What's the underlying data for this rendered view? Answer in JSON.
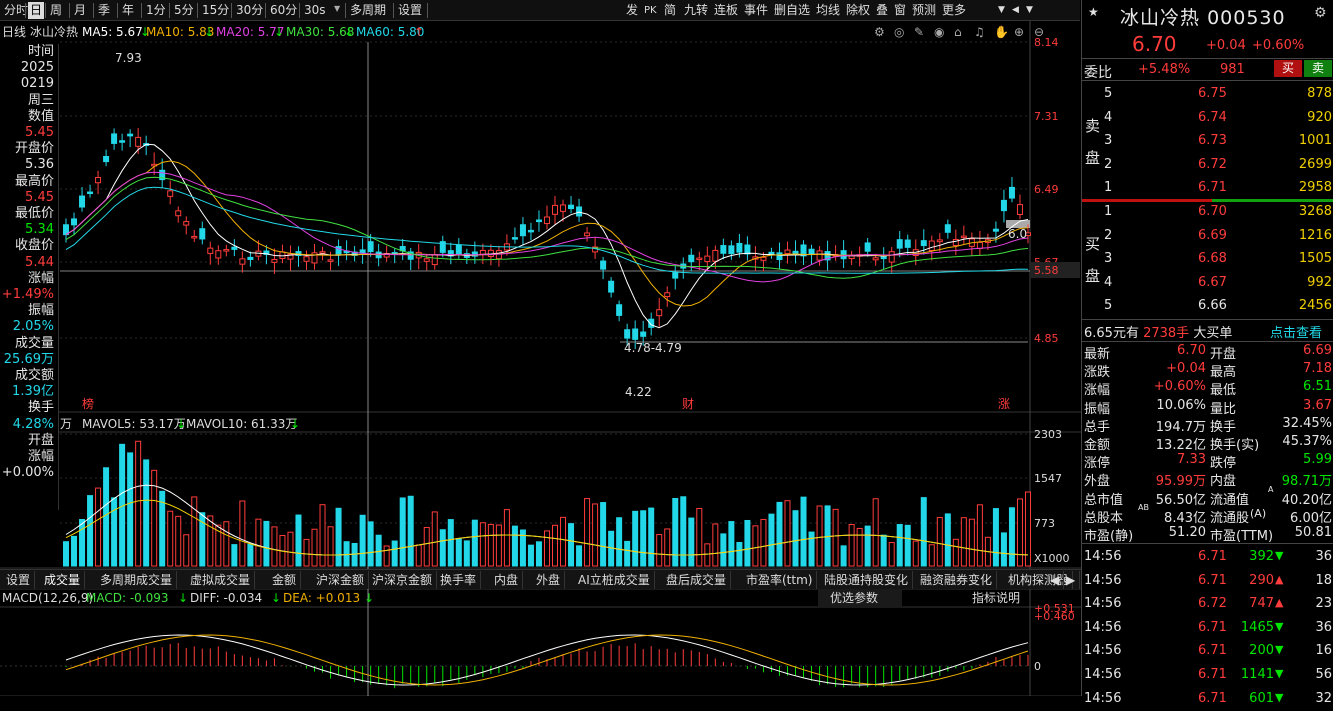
{
  "toolbar": {
    "left": [
      "分时",
      "日",
      "周",
      "月",
      "季",
      "年",
      "1分",
      "5分",
      "15分",
      "30分",
      "60分",
      "30s",
      "多周期",
      "设置"
    ],
    "selected_index": 1,
    "right": [
      "发",
      "PK",
      "简",
      "九转",
      "连板",
      "事件",
      "删自选",
      "均线",
      "除权",
      "叠",
      "窗",
      "预测",
      "更多"
    ]
  },
  "legend": {
    "period": "日线",
    "name": "冰山冷热",
    "ma": [
      {
        "label": "MA5: 5.67",
        "arrow": "↓",
        "color": "#ffffff"
      },
      {
        "label": "MA10: 5.83",
        "arrow": "↓",
        "color": "#f0b000"
      },
      {
        "label": "MA20: 5.77",
        "arrow": "↓",
        "color": "#e040e0"
      },
      {
        "label": "MA30: 5.68",
        "arrow": "↓",
        "color": "#40e040"
      },
      {
        "label": "MA60: 5.80",
        "arrow": "↑",
        "color": "#22d8e8"
      }
    ]
  },
  "price_axis": [
    "8.14",
    "7.31",
    "6.49",
    "5.67",
    "4.85"
  ],
  "volume_axis": [
    "2303",
    "1547",
    "773",
    "X1000"
  ],
  "macd_axis": [
    "+0.531",
    "+0.460",
    "0"
  ],
  "cursor_price": "5.58",
  "annotations": {
    "high": "7.93",
    "low": "4.22",
    "range": "4.78-4.79",
    "level": "6.0",
    "bang": "榜",
    "cai": "财",
    "zhang": "涨"
  },
  "vol_legend": {
    "unit": "万",
    "mavol5": "MAVOL5: 53.17万",
    "mavol5_arrow": "↓",
    "mavol10": "MAVOL10: 61.33万",
    "mavol10_arrow": "↓"
  },
  "macd_legend": {
    "title": "MACD(12,26,9)",
    "macd": "MACD: -0.093",
    "macd_arrow": "↓",
    "diff": "DIFF: -0.034",
    "diff_arrow": "↓",
    "dea": "DEA: +0.013",
    "dea_arrow": "↓"
  },
  "macd_buttons": {
    "optimize": "优选参数",
    "explain": "指标说明"
  },
  "sidebar": [
    {
      "label": "时间",
      "value": "2025"
    },
    {
      "label": "",
      "value": "0219"
    },
    {
      "label": "周三",
      "value": ""
    },
    {
      "label": "数值",
      "value": "5.45",
      "color": "red"
    },
    {
      "label": "开盘价",
      "value": "5.36",
      "color": "wht"
    },
    {
      "label": "最高价",
      "value": "5.45",
      "color": "red"
    },
    {
      "label": "最低价",
      "value": "5.34",
      "color": "grn"
    },
    {
      "label": "收盘价",
      "value": "5.44",
      "color": "red"
    },
    {
      "label": "涨幅",
      "value": "+1.49%",
      "color": "red"
    },
    {
      "label": "振幅",
      "value": "2.05%",
      "color": "cyn"
    },
    {
      "label": "成交量",
      "value": "25.69万",
      "color": "cyn"
    },
    {
      "label": "成交额",
      "value": "1.39亿",
      "color": "cyn"
    },
    {
      "label": "换手",
      "value": "4.28%",
      "color": "cyn"
    },
    {
      "label": "开盘",
      "value": ""
    },
    {
      "label": "涨幅",
      "value": "+0.00%",
      "color": "wht"
    }
  ],
  "tabs": [
    "设置",
    "成交量",
    "多周期成交量",
    "虚拟成交量",
    "金额",
    "沪深金额",
    "沪深京金额",
    "换手率",
    "内盘",
    "外盘",
    "AI立桩成交量",
    "盘后成交量",
    "市盈率(ttm)",
    "陆股通持股变化",
    "融资融券变化",
    "机构探测器"
  ],
  "stock": {
    "name": "冰山冷热",
    "code": "000530",
    "price": "6.70",
    "change": "+0.04",
    "pct": "+0.60%"
  },
  "weibi": {
    "label": "委比",
    "pct": "+5.48%",
    "val": "981",
    "buy": "买",
    "sell": "卖"
  },
  "sell_book": [
    {
      "n": "5",
      "p": "6.75",
      "v": "878"
    },
    {
      "n": "4",
      "p": "6.74",
      "v": "920"
    },
    {
      "n": "3",
      "p": "6.73",
      "v": "1001"
    },
    {
      "n": "2",
      "p": "6.72",
      "v": "2699"
    },
    {
      "n": "1",
      "p": "6.71",
      "v": "2958"
    }
  ],
  "buy_book": [
    {
      "n": "1",
      "p": "6.70",
      "v": "3268"
    },
    {
      "n": "2",
      "p": "6.69",
      "v": "1216"
    },
    {
      "n": "3",
      "p": "6.68",
      "v": "1505"
    },
    {
      "n": "4",
      "p": "6.67",
      "v": "992"
    },
    {
      "n": "5",
      "p": "6.66",
      "v": "2456"
    }
  ],
  "book_side": {
    "sell": [
      "卖",
      "盘"
    ],
    "buy": [
      "买",
      "盘"
    ]
  },
  "big_order": {
    "price": "6.65元有",
    "vol": "2738手",
    "label": "大买单",
    "link": "点击查看"
  },
  "quote": [
    [
      "最新",
      "6.70",
      "red",
      "开盘",
      "6.69",
      "red"
    ],
    [
      "涨跌",
      "+0.04",
      "red",
      "最高",
      "7.18",
      "red"
    ],
    [
      "涨幅",
      "+0.60%",
      "red",
      "最低",
      "6.51",
      "grn"
    ],
    [
      "振幅",
      "10.06%",
      "wht",
      "量比",
      "3.67",
      "red"
    ],
    [
      "总手",
      "194.7万",
      "wht",
      "换手",
      "32.45%",
      "wht"
    ],
    [
      "金额",
      "13.22亿",
      "wht",
      "换手(实)",
      "45.37%",
      "wht"
    ],
    [
      "涨停",
      "7.33",
      "red",
      "跌停",
      "5.99",
      "grn"
    ],
    [
      "外盘",
      "95.99万",
      "red",
      "内盘",
      "98.71万",
      "grn"
    ],
    [
      "总市值",
      "56.50亿",
      "wht",
      "流通值",
      "40.20亿",
      "wht"
    ],
    [
      "总股本",
      "8.43亿",
      "wht",
      "流通股",
      "6.00亿",
      "wht"
    ],
    [
      "市盈(静)",
      "51.20",
      "wht",
      "市盈(TTM)",
      "50.81",
      "wht"
    ]
  ],
  "quote_sup": {
    "shizhi": "A",
    "guben": "AB",
    "liutong": "(A)"
  },
  "ticks": [
    {
      "t": "14:56",
      "p": "6.71",
      "v": "392",
      "d": "down",
      "n": "36"
    },
    {
      "t": "14:56",
      "p": "6.71",
      "v": "290",
      "d": "up",
      "n": "18"
    },
    {
      "t": "14:56",
      "p": "6.72",
      "v": "747",
      "d": "up",
      "n": "23"
    },
    {
      "t": "14:56",
      "p": "6.71",
      "v": "1465",
      "d": "down",
      "n": "36"
    },
    {
      "t": "14:56",
      "p": "6.71",
      "v": "200",
      "d": "down",
      "n": "16"
    },
    {
      "t": "14:56",
      "p": "6.71",
      "v": "1141",
      "d": "down",
      "n": "56"
    },
    {
      "t": "14:56",
      "p": "6.71",
      "v": "601",
      "d": "down",
      "n": "32"
    }
  ],
  "colors": {
    "up": "#ff3c3c",
    "down": "#22d8e8",
    "bg": "#000000"
  }
}
